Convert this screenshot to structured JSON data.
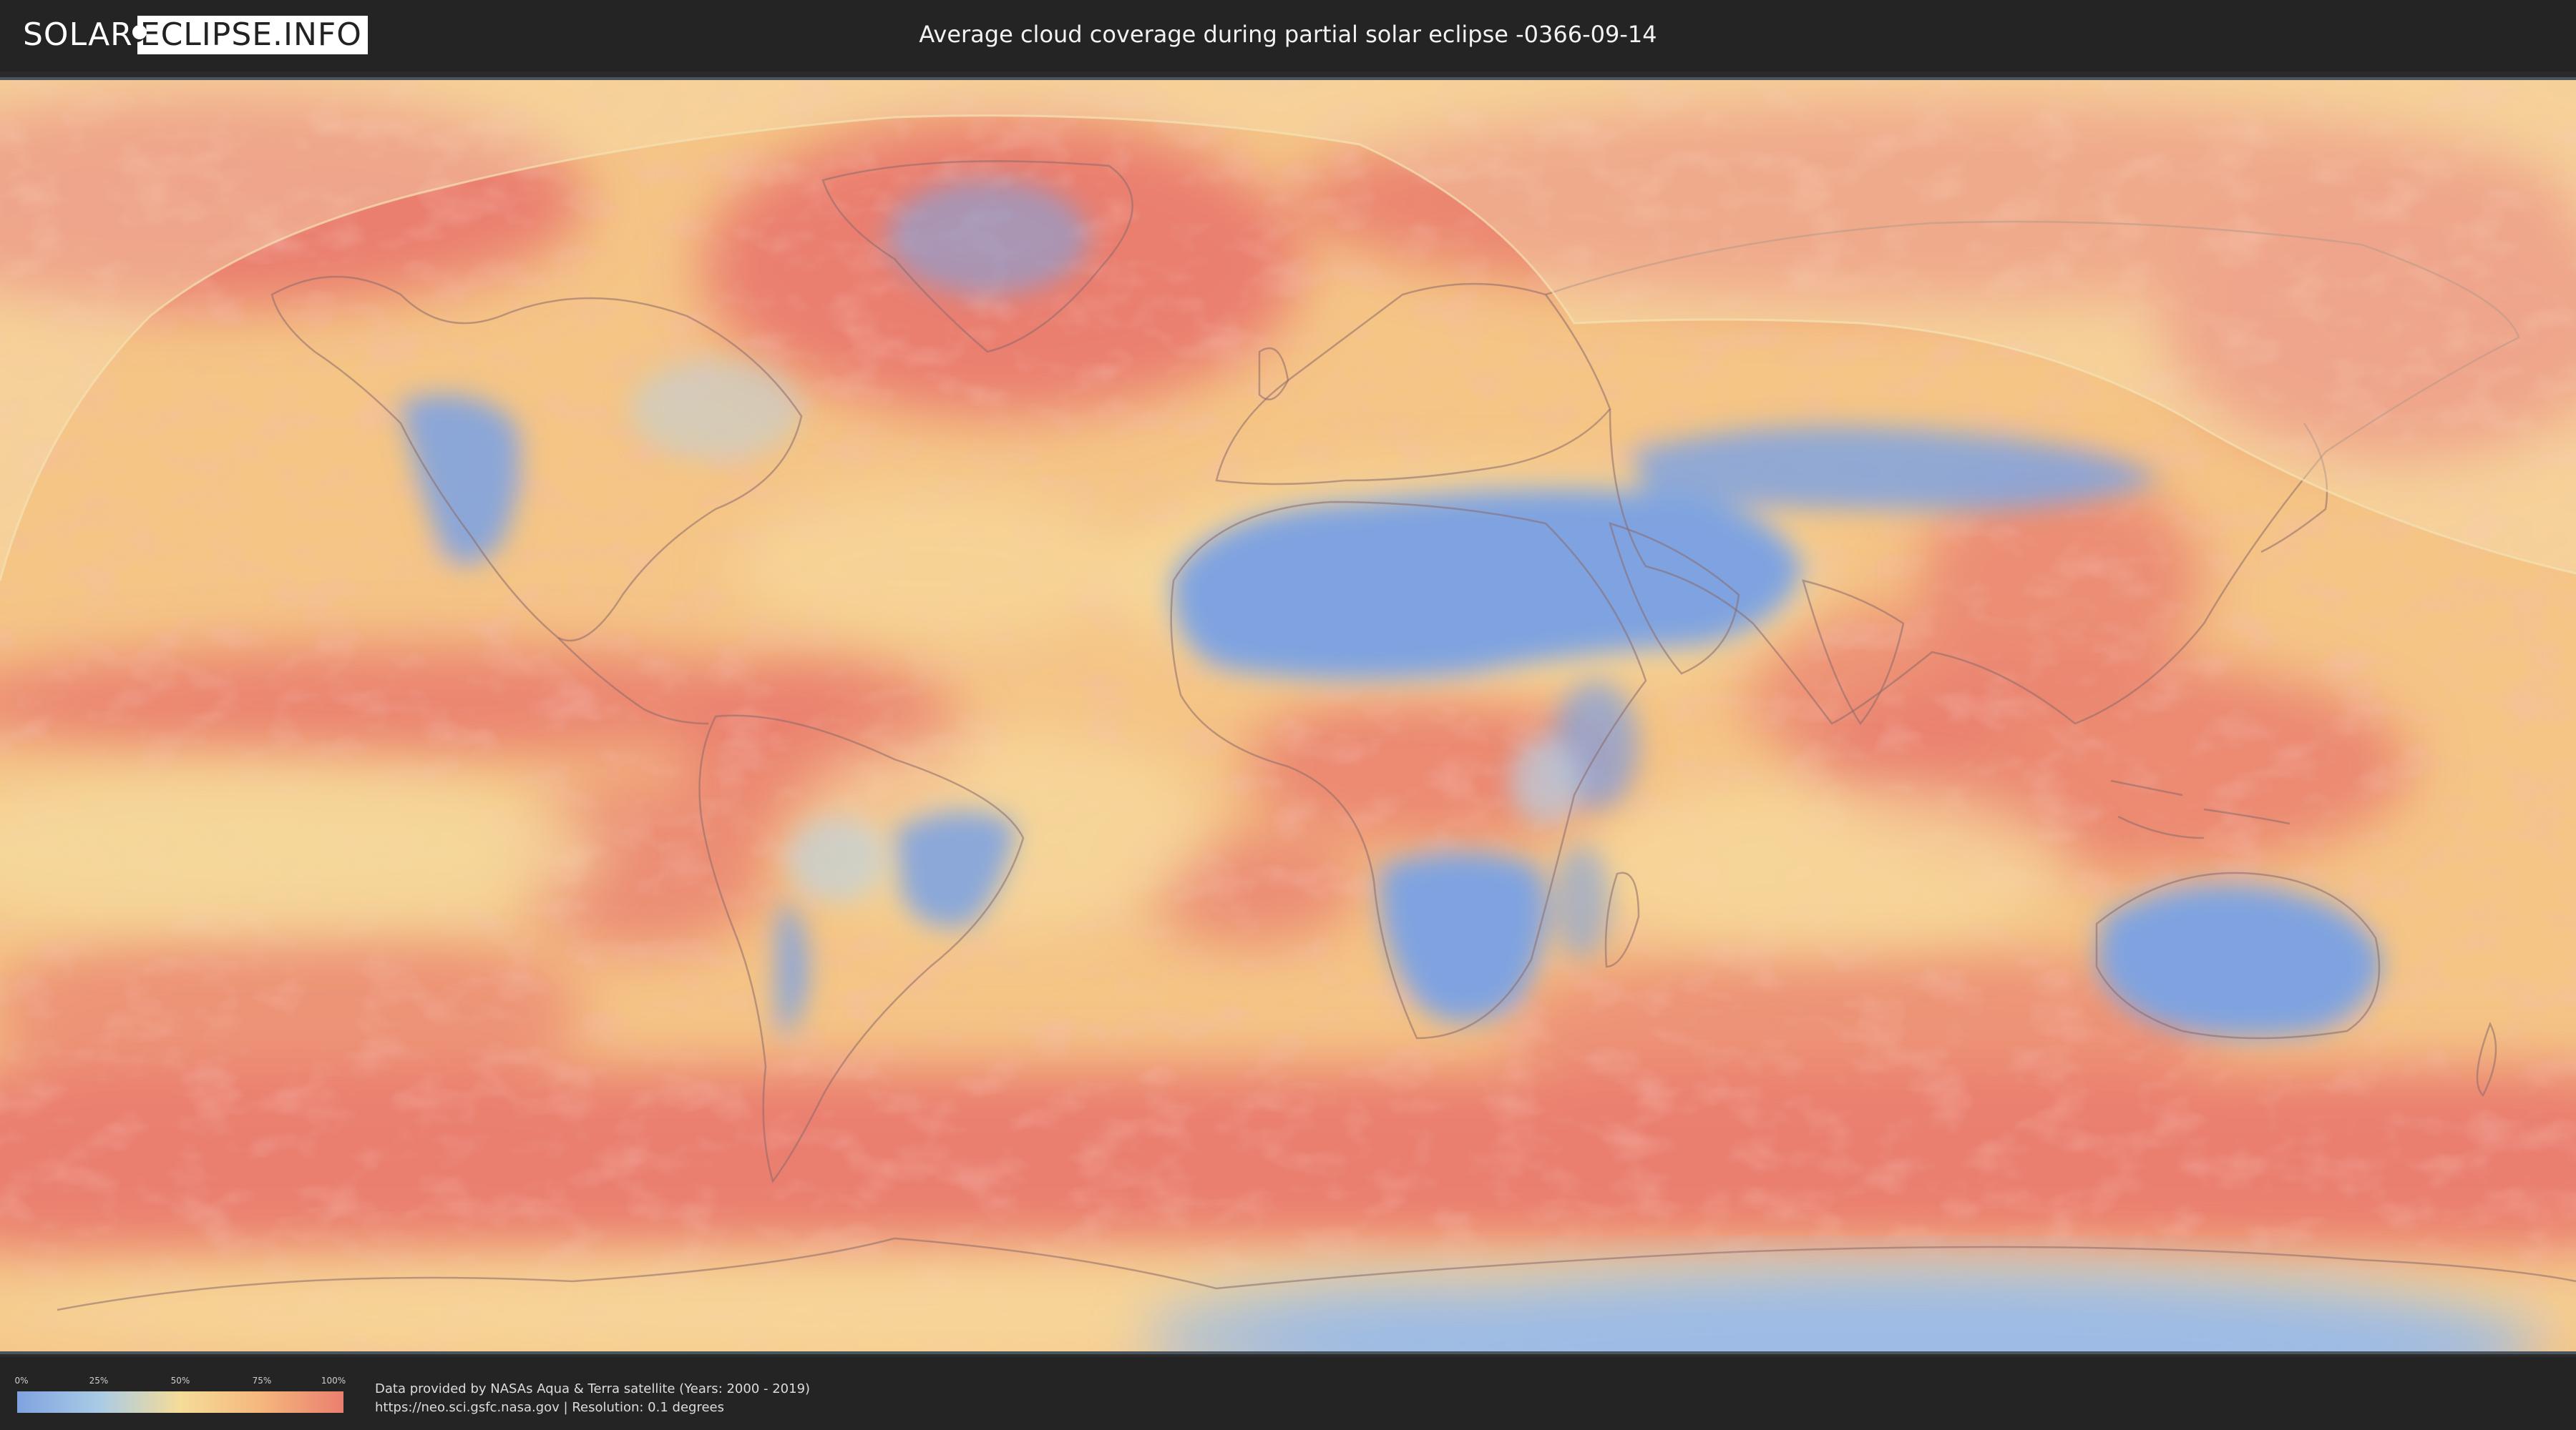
{
  "header": {
    "logo_left": "SOLAR",
    "logo_right": "ECLIPSE.INFO",
    "title": "Average cloud coverage during partial solar eclipse -0366-09-14"
  },
  "map": {
    "colors": {
      "clear": "#7fa3e0",
      "low": "#a9cbe6",
      "mid": "#f5dc98",
      "high_mid": "#f5b67c",
      "cloudy": "#ea7f6f",
      "eclipse_overlay": "#f7e6b8",
      "frame": "#4a5560"
    },
    "layers": [
      "cloud-coverage",
      "country-borders",
      "eclipse-visibility-zone"
    ]
  },
  "legend": {
    "ticks": [
      "0%",
      "25%",
      "50%",
      "75%",
      "100%"
    ],
    "gradient": [
      "#7fa3e0",
      "#a9cbe6",
      "#f5dc98",
      "#f5b67c",
      "#ea7f6f"
    ]
  },
  "footer": {
    "line1": "Data provided by NASAs Aqua & Terra satellite (Years: 2000 - 2019)",
    "line2": "https://neo.sci.gsfc.nasa.gov | Resolution: 0.1 degrees"
  }
}
